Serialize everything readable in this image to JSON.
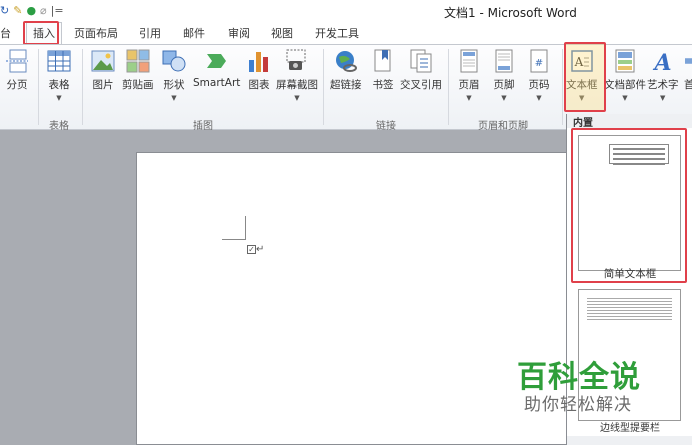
{
  "window": {
    "title": "文档1 - Microsoft Word"
  },
  "quick_access": {
    "left_fragment": "台",
    "separator": "|="
  },
  "tabs": [
    {
      "label": "台"
    },
    {
      "label": "插入",
      "active": true
    },
    {
      "label": "页面布局"
    },
    {
      "label": "引用"
    },
    {
      "label": "邮件"
    },
    {
      "label": "审阅"
    },
    {
      "label": "视图"
    },
    {
      "label": "开发工具"
    }
  ],
  "ribbon": {
    "buttons": [
      {
        "label": "分页",
        "icon": "page-break-icon"
      },
      {
        "label": "表格",
        "icon": "table-icon",
        "dropdown": true
      },
      {
        "label": "图片",
        "icon": "picture-icon"
      },
      {
        "label": "剪贴画",
        "icon": "clipart-icon"
      },
      {
        "label": "形状",
        "icon": "shapes-icon",
        "dropdown": true
      },
      {
        "label": "SmartArt",
        "icon": "smartart-icon"
      },
      {
        "label": "图表",
        "icon": "chart-icon"
      },
      {
        "label": "屏幕截图",
        "icon": "screenshot-icon",
        "dropdown": true
      },
      {
        "label": "超链接",
        "icon": "hyperlink-icon"
      },
      {
        "label": "书签",
        "icon": "bookmark-icon"
      },
      {
        "label": "交叉引用",
        "icon": "cross-reference-icon"
      },
      {
        "label": "页眉",
        "icon": "header-icon",
        "dropdown": true
      },
      {
        "label": "页脚",
        "icon": "footer-icon",
        "dropdown": true
      },
      {
        "label": "页码",
        "icon": "page-number-icon",
        "dropdown": true
      },
      {
        "label": "文本框",
        "icon": "text-box-icon",
        "dropdown": true,
        "active": true
      },
      {
        "label": "文档部件",
        "icon": "quick-parts-icon",
        "dropdown": true
      },
      {
        "label": "艺术字",
        "icon": "wordart-icon",
        "dropdown": true
      },
      {
        "label": "首",
        "icon": "drop-cap-icon"
      }
    ],
    "groups": [
      {
        "label": "表格"
      },
      {
        "label": "插图"
      },
      {
        "label": "链接"
      },
      {
        "label": "页眉和页脚"
      }
    ]
  },
  "document": {
    "paragraph_mark": "↵"
  },
  "gallery": {
    "header": "内置",
    "items": [
      {
        "label": "简单文本框",
        "highlighted": true
      },
      {
        "label": "边线型提要栏"
      }
    ]
  },
  "watermark": {
    "title": "百科全说",
    "subtitle": "助你轻松解决"
  },
  "colors": {
    "highlight": "#e0404a",
    "watermark_green": "#2f9e3a",
    "workspace": "#a9acb2"
  }
}
